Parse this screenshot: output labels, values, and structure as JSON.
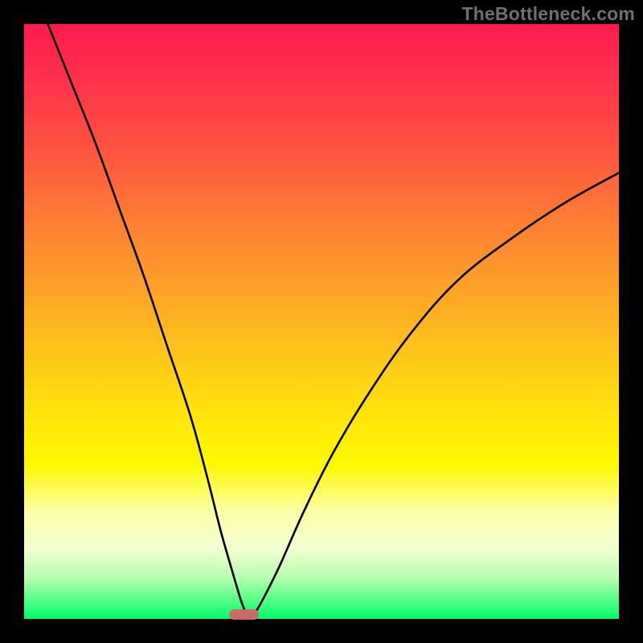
{
  "watermark": "TheBottleneck.com",
  "colors": {
    "frame": "#000000",
    "gradient_top": "#ff1a4d",
    "gradient_mid": "#ffe60a",
    "gradient_bottom": "#00ff66",
    "curve": "#000000",
    "marker": "#cc6b66"
  },
  "chart_data": {
    "type": "line",
    "title": "",
    "xlabel": "",
    "ylabel": "",
    "xlim": [
      0,
      100
    ],
    "ylim": [
      0,
      100
    ],
    "shape": "absolute-deviation V-curve",
    "minimum_x_pct": 37,
    "series": [
      {
        "name": "left-branch",
        "x": [
          4,
          8,
          12,
          16,
          20,
          24,
          28,
          31,
          33,
          35,
          36.5,
          37.5
        ],
        "y_pct": [
          100,
          90,
          80,
          69,
          58,
          46,
          34,
          23,
          15,
          8,
          3,
          0.5
        ]
      },
      {
        "name": "right-branch",
        "x": [
          38.5,
          40,
          43,
          47,
          52,
          58,
          65,
          73,
          82,
          91,
          100
        ],
        "y_pct": [
          0.5,
          3,
          9,
          18,
          28,
          38,
          48,
          57,
          64,
          70,
          75
        ]
      }
    ],
    "marker": {
      "x_pct": 37,
      "width_pct": 5,
      "y_pct": 0.8
    },
    "grid": false,
    "legend": false
  }
}
